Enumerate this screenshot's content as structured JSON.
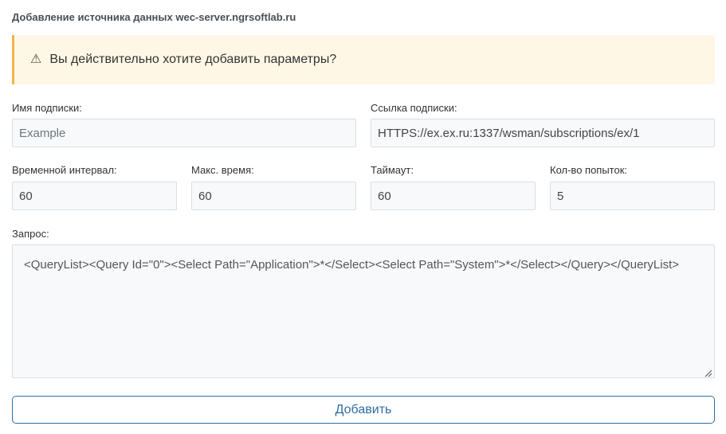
{
  "page": {
    "title": "Добавление источника данных wec-server.ngrsoftlab.ru"
  },
  "alert": {
    "icon": "warning-icon",
    "text": "Вы действительно хотите добавить параметры?"
  },
  "form": {
    "subscription_name": {
      "label": "Имя подписки:",
      "placeholder": "Example",
      "value": ""
    },
    "subscription_link": {
      "label": "Ссылка подписки:",
      "value": "HTTPS://ex.ex.ru:1337/wsman/subscriptions/ex/1"
    },
    "time_interval": {
      "label": "Временной интервал:",
      "value": "60"
    },
    "max_time": {
      "label": "Макс. время:",
      "value": "60"
    },
    "timeout": {
      "label": "Таймаут:",
      "value": "60"
    },
    "retry_count": {
      "label": "Кол-во попыток:",
      "value": "5"
    },
    "query": {
      "label": "Запрос:",
      "value": "<QueryList><Query Id=\"0\"><Select Path=\"Application\">*</Select><Select Path=\"System\">*</Select></Query></QueryList>"
    }
  },
  "actions": {
    "submit_label": "Добавить"
  },
  "colors": {
    "alert_bg": "#fff7e6",
    "alert_border": "#f0b54a",
    "button_accent": "#2f6ea3"
  }
}
